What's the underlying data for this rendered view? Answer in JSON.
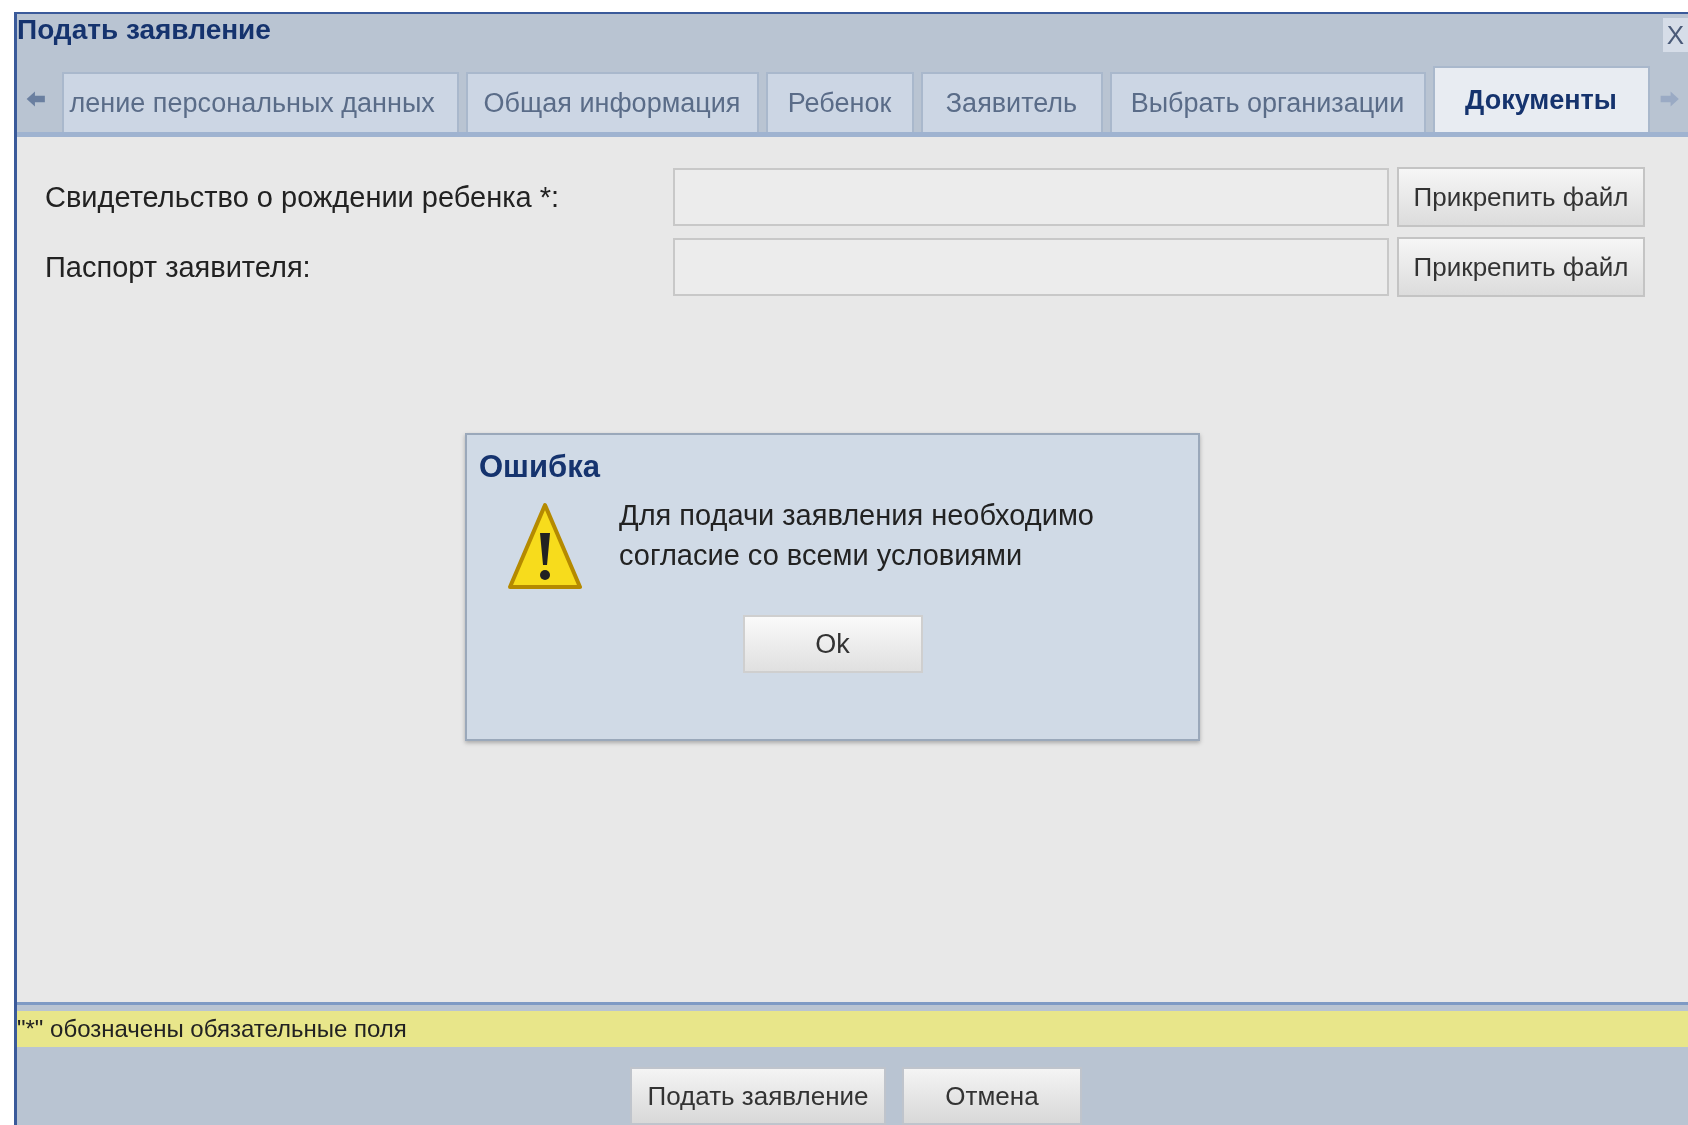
{
  "window": {
    "title": "Подать заявление",
    "close": "X"
  },
  "tabs": [
    {
      "label": "ление персональных данных",
      "selected": false
    },
    {
      "label": "Общая информация",
      "selected": false
    },
    {
      "label": "Ребенок",
      "selected": false
    },
    {
      "label": "Заявитель",
      "selected": false
    },
    {
      "label": "Выбрать организации",
      "selected": false
    },
    {
      "label": "Документы",
      "selected": true
    }
  ],
  "fields": [
    {
      "label": "Свидетельство о рождении ребенка *:",
      "button": "Прикрепить файл"
    },
    {
      "label": "Паспорт заявителя:",
      "button": "Прикрепить файл"
    }
  ],
  "dialog": {
    "title": "Ошибка",
    "message": "Для подачи заявления необходимо согласие со всеми условиями",
    "button": "Ok"
  },
  "hint": "\"*\" обозначены обязательные поля",
  "buttons": [
    "Подать заявление",
    "Отмена"
  ]
}
